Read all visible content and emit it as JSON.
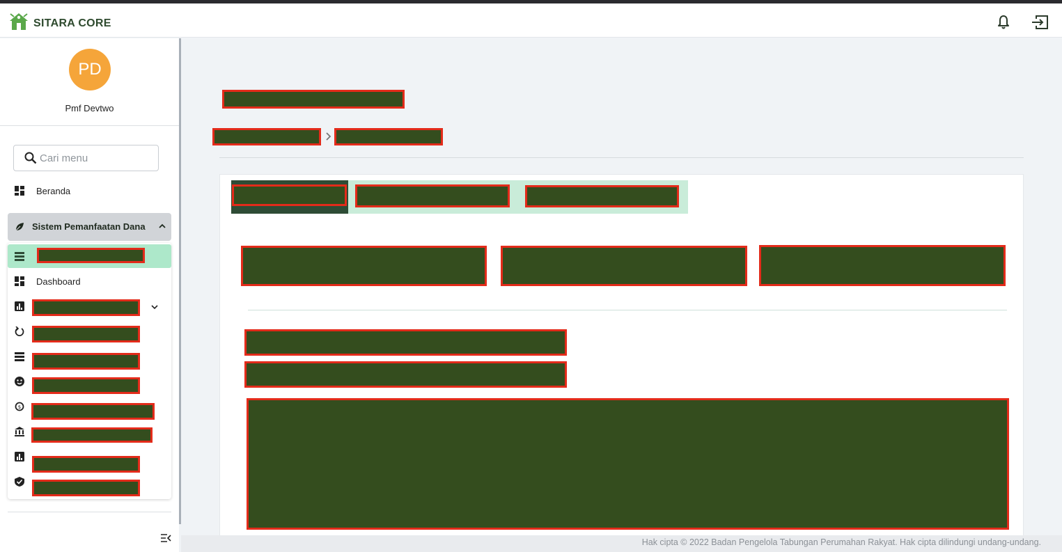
{
  "app": {
    "brand": "SITARA CORE"
  },
  "header": {
    "bell_icon": "bell-icon",
    "logout_icon": "logout-icon"
  },
  "profile": {
    "initials": "PD",
    "name": "Pmf Devtwo",
    "avatar_color": "#f5a53a"
  },
  "search": {
    "placeholder": "Cari menu"
  },
  "sidebar": {
    "home_label": "Beranda",
    "group_label": "Sistem Pemanfaatan Dana",
    "submenu": {
      "dashboard_label": "Dashboard"
    }
  },
  "footer": {
    "copyright": "Hak cipta © 2022 Badan Pengelola Tabungan Perumahan Rakyat. Hak cipta dilindungi undang-undang."
  },
  "colors": {
    "brand_green": "#2e4a2e",
    "active_menu": "#ade8ca",
    "tab_strip": "#c9ecd9",
    "tab_active": "#2e4c36",
    "redaction_fill": "#344d1e",
    "redaction_border": "#e32b1a"
  }
}
